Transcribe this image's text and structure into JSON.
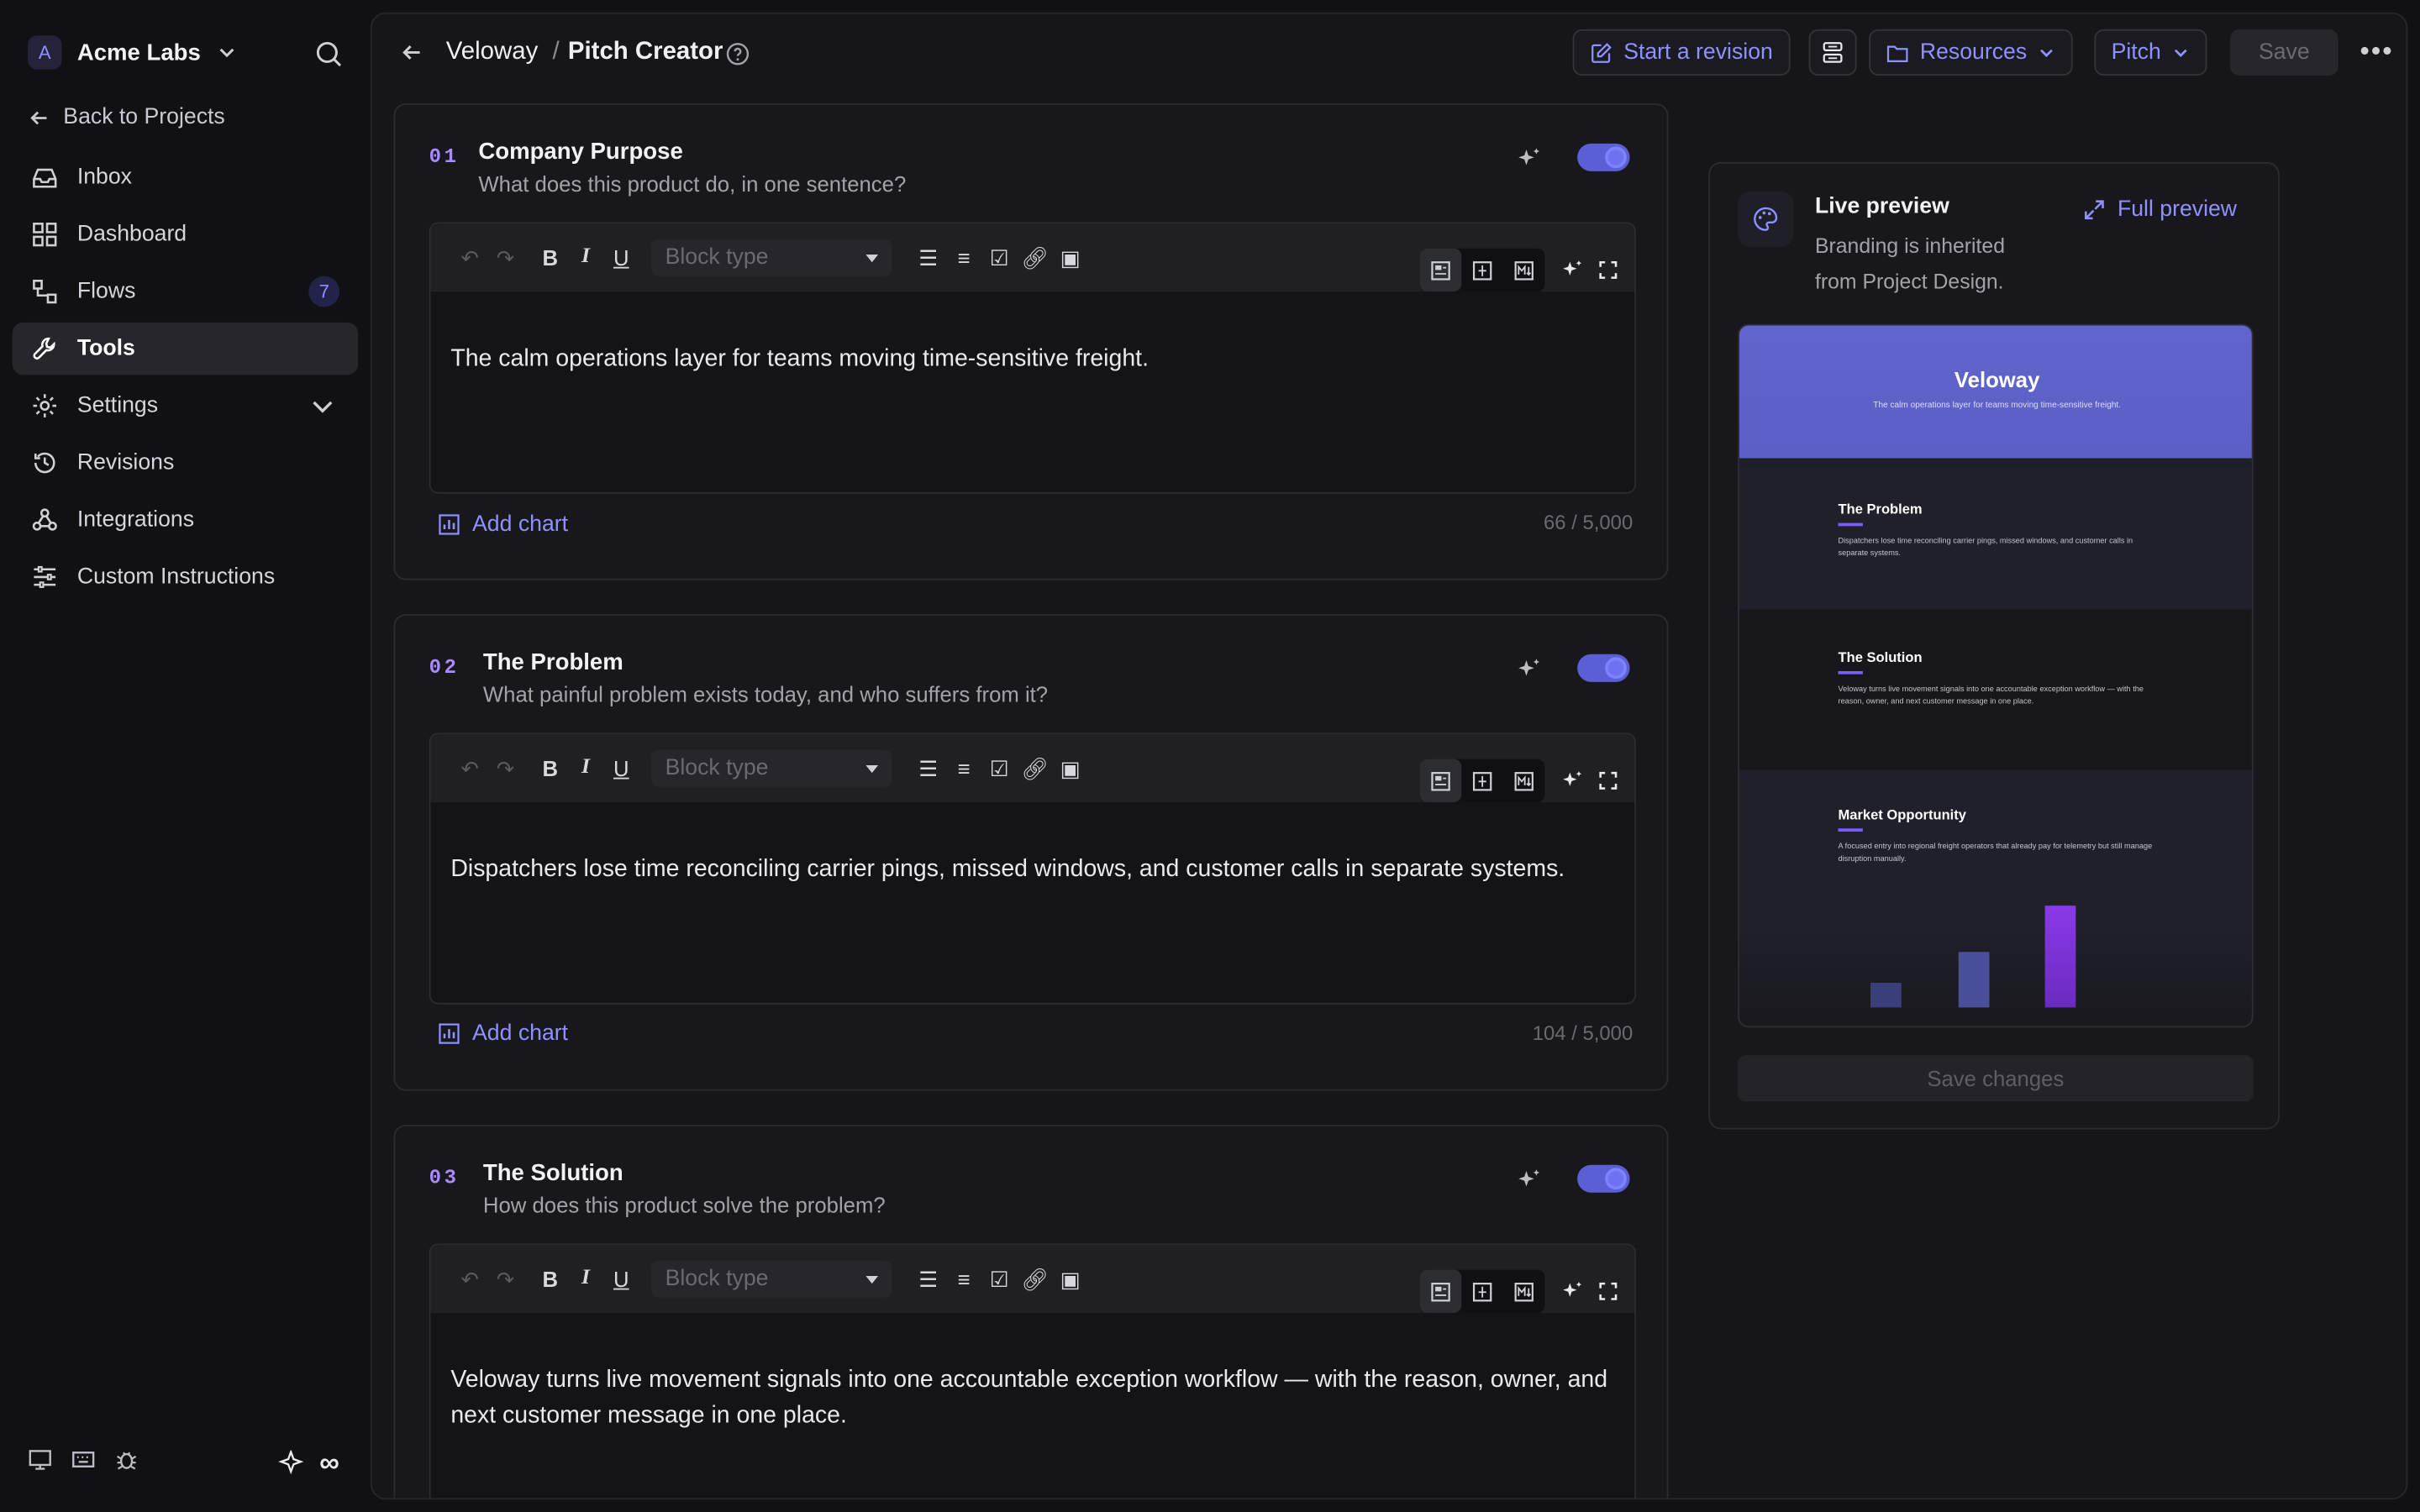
{
  "workspace": {
    "initial": "A",
    "name": "Acme Labs"
  },
  "sidebar": {
    "back_label": "Back to Projects",
    "items": [
      {
        "label": "Inbox",
        "icon": "inbox-icon"
      },
      {
        "label": "Dashboard",
        "icon": "dashboard-icon"
      },
      {
        "label": "Flows",
        "icon": "flows-icon",
        "badge": "7"
      },
      {
        "label": "Tools",
        "icon": "wrench-icon",
        "active": true
      },
      {
        "label": "Settings",
        "icon": "gear-icon"
      },
      {
        "label": "Revisions",
        "icon": "history-icon"
      },
      {
        "label": "Integrations",
        "icon": "webhook-icon"
      },
      {
        "label": "Custom Instructions",
        "icon": "sliders-icon"
      }
    ],
    "footer_symbol": "∞"
  },
  "topbar": {
    "project": "Veloway",
    "separator": "/",
    "page": "Pitch Creator",
    "start_revision": "Start a revision",
    "resources": "Resources",
    "pitch": "Pitch",
    "save": "Save"
  },
  "sections": [
    {
      "num": "01",
      "title": "Company Purpose",
      "subtitle": "What does this product do, in one sentence?",
      "block_type": "Block type",
      "text": "The calm operations layer for teams moving time-sensitive freight.",
      "add_chart": "Add chart",
      "count": "66 / 5,000"
    },
    {
      "num": "02",
      "title": "The Problem",
      "subtitle": "What painful problem exists today, and who suffers from it?",
      "block_type": "Block type",
      "text": "Dispatchers lose time reconciling carrier pings, missed windows, and customer calls in separate systems.",
      "add_chart": "Add chart",
      "count": "104 / 5,000"
    },
    {
      "num": "03",
      "title": "The Solution",
      "subtitle": "How does this product solve the problem?",
      "block_type": "Block type",
      "text": "Veloway turns live movement signals into one accountable exception workflow — with the reason, owner, and next customer message in one place."
    }
  ],
  "preview": {
    "title": "Live preview",
    "subtitle": "Branding is inherited from Project Design.",
    "full_preview": "Full preview",
    "save_changes": "Save changes",
    "slides": {
      "cover_title": "Veloway",
      "cover_text": "The calm operations layer for teams moving time-sensitive freight.",
      "problem_title": "The Problem",
      "problem_text": "Dispatchers lose time reconciling carrier pings, missed windows, and customer calls in separate systems.",
      "solution_title": "The Solution",
      "solution_text": "Veloway turns live movement signals into one accountable exception workflow — with the reason, owner, and next customer message in one place.",
      "market_title": "Market Opportunity",
      "market_text": "A focused entry into regional freight operators that already pay for telemetry but still manage disruption manually."
    }
  },
  "colors": {
    "accent": "#8e91ff",
    "toggle": "#5a5fd6",
    "number": "#a98bff"
  }
}
